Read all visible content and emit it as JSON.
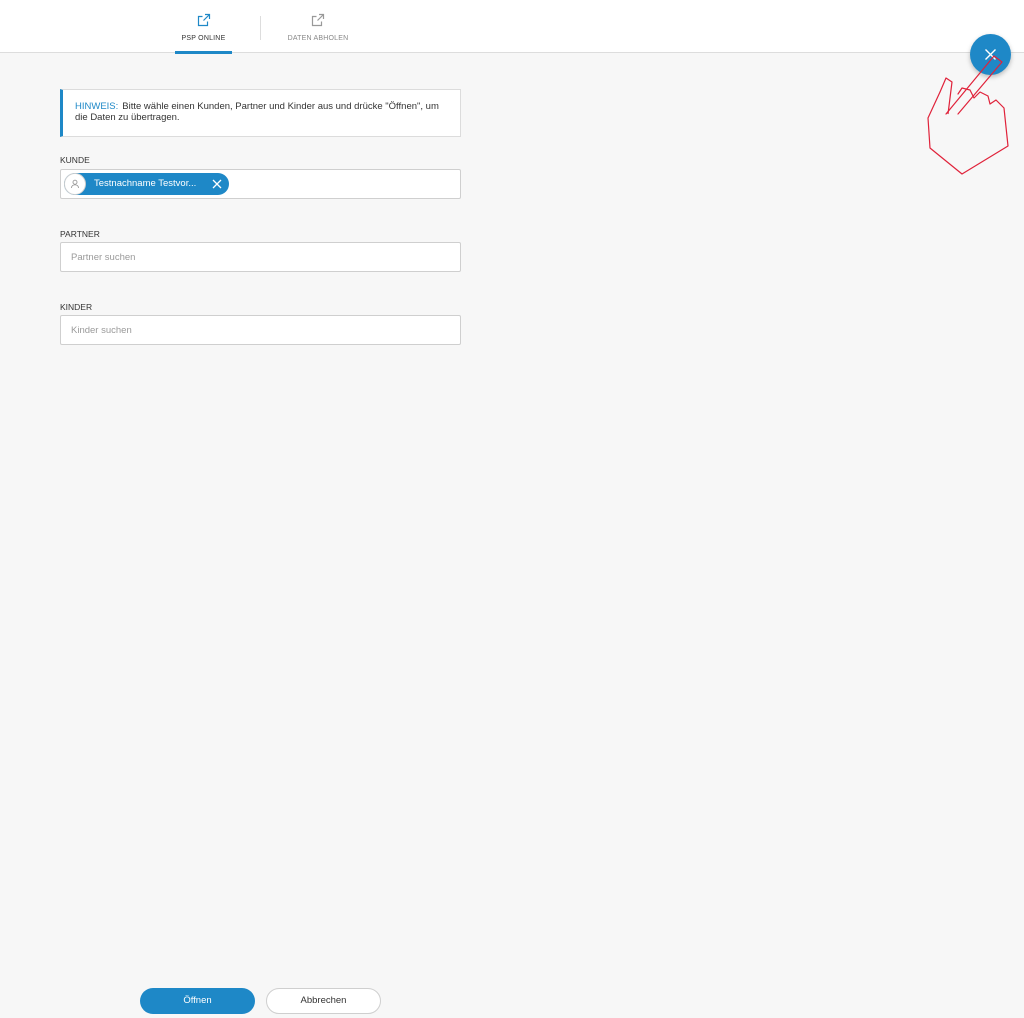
{
  "tabs": [
    {
      "label": "PSP ONLINE",
      "icon": "external-link-icon",
      "active": true
    },
    {
      "label": "DATEN ABHOLEN",
      "icon": "external-link-icon",
      "active": false
    }
  ],
  "fab": {
    "icon": "close-icon"
  },
  "notice": {
    "title": "HINWEIS:",
    "text": "Bitte wähle einen Kunden, Partner und Kinder aus und drücke \"Öffnen\", um die Daten zu übertragen."
  },
  "kunde": {
    "label": "KUNDE",
    "chip_text": "Testnachname Testvor...",
    "avatar_icon": "person-icon"
  },
  "partner": {
    "label": "PARTNER",
    "placeholder": "Partner suchen"
  },
  "kinder": {
    "label": "KINDER",
    "placeholder": "Kinder suchen"
  },
  "buttons": {
    "open_label": "Öffnen",
    "cancel_label": "Abbrechen"
  },
  "colors": {
    "accent": "#1e88c7",
    "hint_hand": "#e0223a"
  }
}
